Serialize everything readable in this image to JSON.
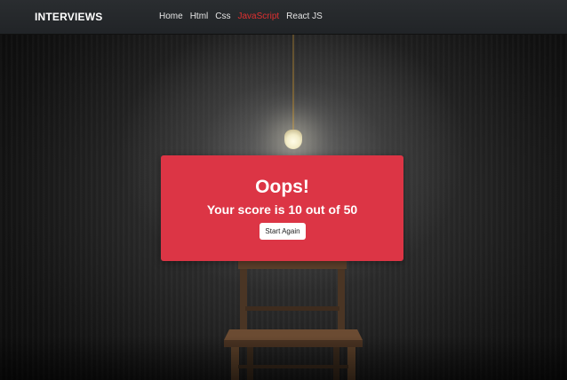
{
  "navbar": {
    "brand": "INTERVIEWS",
    "links": [
      {
        "label": "Home"
      },
      {
        "label": "Html"
      },
      {
        "label": "Css"
      },
      {
        "label": "JavaScript",
        "active": true
      },
      {
        "label": "React JS"
      }
    ],
    "active_color": "#e03030"
  },
  "result": {
    "title": "Oops!",
    "score_text": "Your score is 10 out of 50",
    "score": 10,
    "total": 50,
    "button_label": "Start Again",
    "card_color": "#dc3545"
  }
}
